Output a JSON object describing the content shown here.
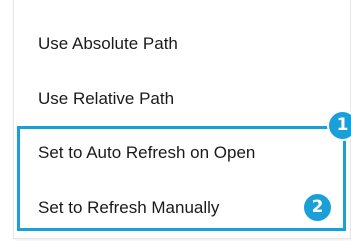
{
  "context_menu": {
    "items": [
      {
        "label": "Use Absolute Path"
      },
      {
        "label": "Use Relative Path"
      },
      {
        "label": "Set to Auto Refresh on Open"
      },
      {
        "label": "Set to Refresh Manually"
      }
    ]
  },
  "callouts": [
    {
      "label": "1"
    },
    {
      "label": "2"
    }
  ],
  "colors": {
    "accent": "#1aa0d8",
    "text": "#1a1a1a",
    "background": "#ffffff"
  }
}
